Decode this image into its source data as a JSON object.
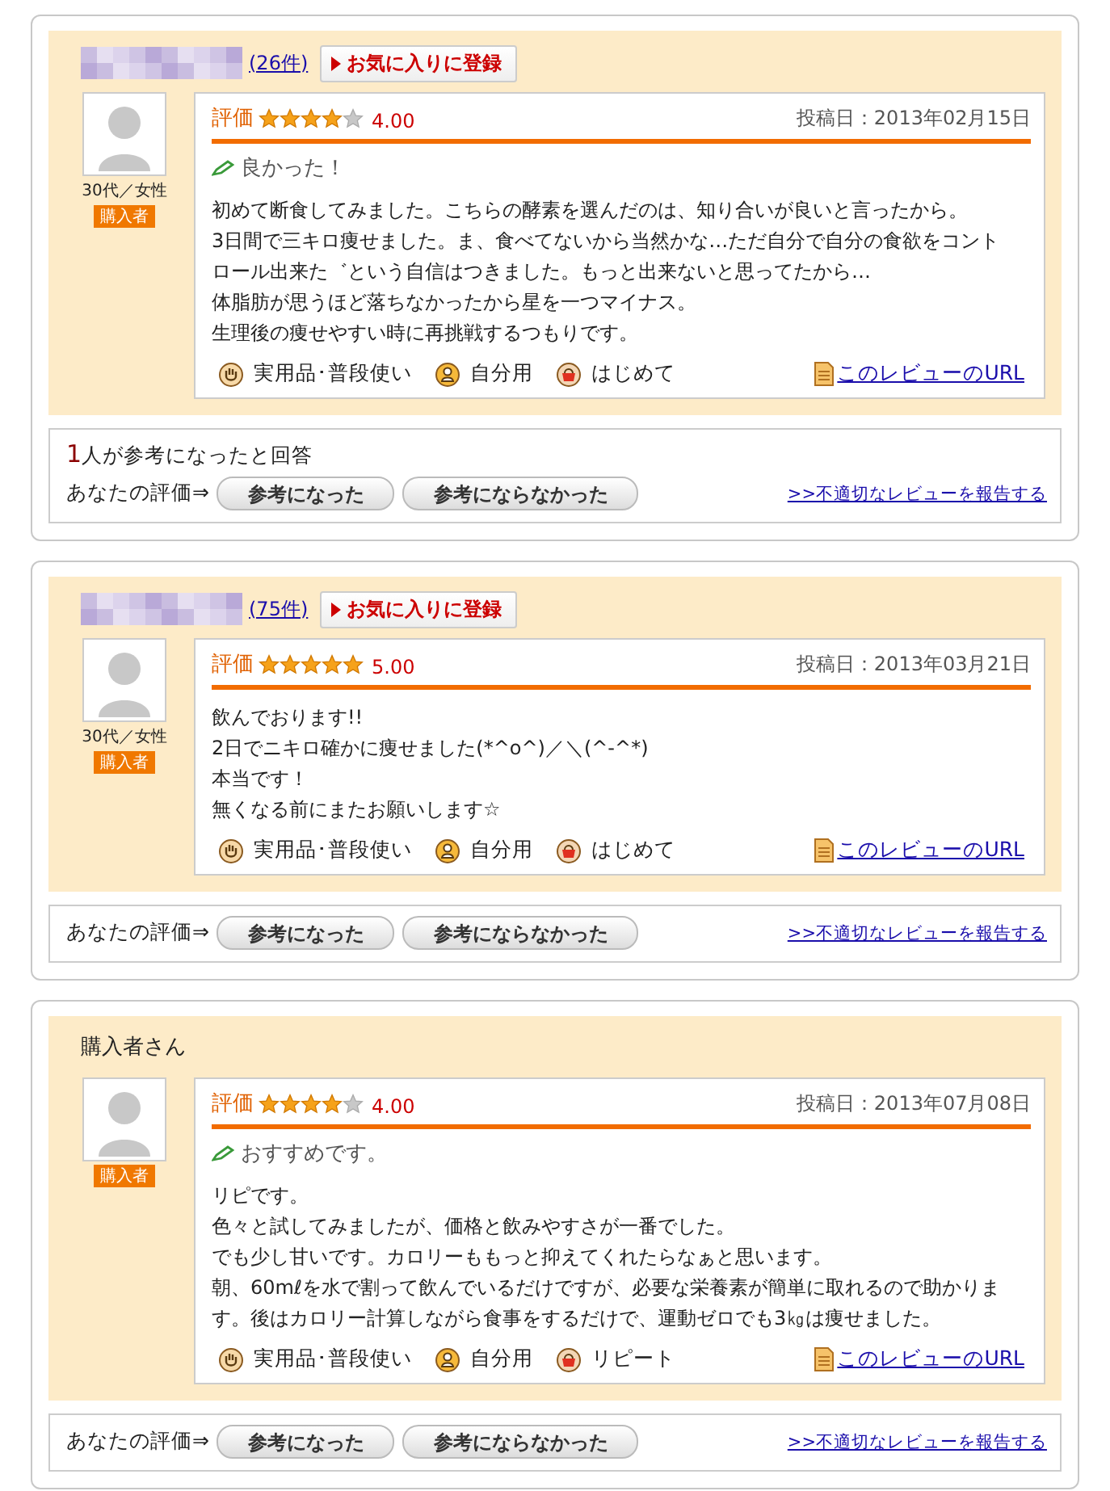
{
  "reviews": [
    {
      "reviewer": {
        "kind": "blurred",
        "count": "(26件)",
        "age_gender": "30代／女性",
        "badge": "購入者"
      },
      "favorite_button": "お気に入りに登録",
      "rating_label": "評価",
      "stars": 4,
      "score": "4.00",
      "posted": "投稿日：2013年02月15日",
      "title": "良かった！",
      "body": [
        "初めて断食してみました。こちらの酵素を選んだのは、知り合いが良いと言ったから。",
        "3日間で三キロ痩せました。ま、食べてないから当然かな…ただ自分で自分の食欲をコント",
        "ロール出来た゛という自信はつきました。もっと出来ないと思ってたから…",
        "体脂肪が思うほど落ちなかったから星を一つマイナス。",
        "生理後の痩せやすい時に再挑戦するつもりです。"
      ],
      "tags": [
        {
          "kind": "usage",
          "label": "実用品･普段使い"
        },
        {
          "kind": "self",
          "label": "自分用"
        },
        {
          "kind": "purchase",
          "label": "はじめて"
        }
      ],
      "url_link": "このレビューのURL",
      "helpful": {
        "count": "1",
        "text": "人が参考になったと回答"
      },
      "your_rating": "あなたの評価⇒",
      "buttons": [
        "参考になった",
        "参考にならなかった"
      ],
      "report_link": ">>不適切なレビューを報告する"
    },
    {
      "reviewer": {
        "kind": "blurred",
        "count": "(75件)",
        "age_gender": "30代／女性",
        "badge": "購入者"
      },
      "favorite_button": "お気に入りに登録",
      "rating_label": "評価",
      "stars": 5,
      "score": "5.00",
      "posted": "投稿日：2013年03月21日",
      "body": [
        "飲んでおります!!",
        "2日でニキロ確かに痩せました(*^o^)／＼(^-^*)",
        "本当です！",
        "無くなる前にまたお願いします☆"
      ],
      "tags": [
        {
          "kind": "usage",
          "label": "実用品･普段使い"
        },
        {
          "kind": "self",
          "label": "自分用"
        },
        {
          "kind": "purchase",
          "label": "はじめて"
        }
      ],
      "url_link": "このレビューのURL",
      "your_rating": "あなたの評価⇒",
      "buttons": [
        "参考になった",
        "参考にならなかった"
      ],
      "report_link": ">>不適切なレビューを報告する"
    },
    {
      "reviewer": {
        "kind": "named",
        "name": "購入者さん",
        "badge": "購入者"
      },
      "rating_label": "評価",
      "stars": 4,
      "score": "4.00",
      "posted": "投稿日：2013年07月08日",
      "title": "おすすめです。",
      "body": [
        "リピです。",
        "色々と試してみましたが、価格と飲みやすさが一番でした。",
        "でも少し甘いです。カロリーももっと抑えてくれたらなぁと思います。",
        "朝、60mℓを水で割って飲んでいるだけですが、必要な栄養素が簡単に取れるので助かりま",
        "す。後はカロリー計算しながら食事をするだけで、運動ゼロでも3㎏は痩せました。"
      ],
      "tags": [
        {
          "kind": "usage",
          "label": "実用品･普段使い"
        },
        {
          "kind": "self",
          "label": "自分用"
        },
        {
          "kind": "purchase",
          "label": "リピート"
        }
      ],
      "url_link": "このレビューのURL",
      "your_rating": "あなたの評価⇒",
      "buttons": [
        "参考になった",
        "参考にならなかった"
      ],
      "report_link": ">>不適切なレビューを報告する"
    }
  ]
}
